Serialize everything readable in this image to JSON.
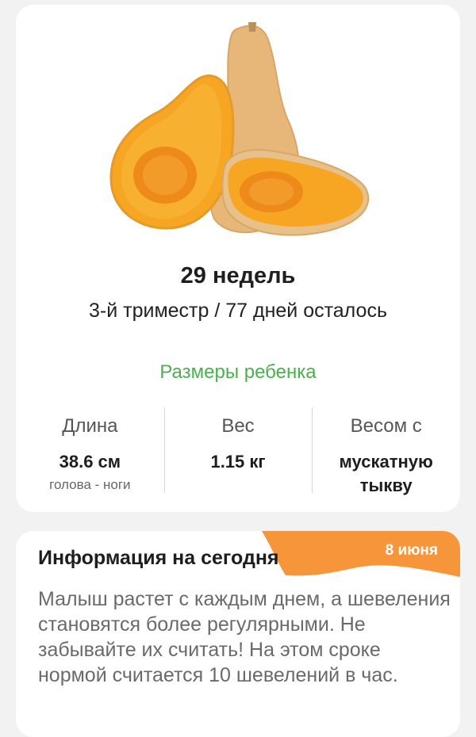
{
  "week_card": {
    "image_icon": "butternut-squash-image",
    "title": "29 недель",
    "subtitle": "3-й триместр / 77 дней осталось",
    "sizes_heading": "Размеры ребенка",
    "stats": [
      {
        "label": "Длина",
        "value": "38.6 см",
        "note": "голова - ноги"
      },
      {
        "label": "Вес",
        "value": "1.15 кг",
        "note": ""
      },
      {
        "label": "Весом с",
        "value": "мускатную тыкву",
        "note": ""
      }
    ]
  },
  "info_card": {
    "title": "Информация на сегодня",
    "date": "8 июня",
    "text": "Малыш растет с каждым днем, а шевеления становятся более регулярными. Не забывайте их считать! На этом сроке нормой считается 10 шевелений в час."
  },
  "colors": {
    "accent_green": "#4caf50",
    "ribbon_orange": "#f7953a",
    "pumpkin_orange": "#f29a1f"
  }
}
